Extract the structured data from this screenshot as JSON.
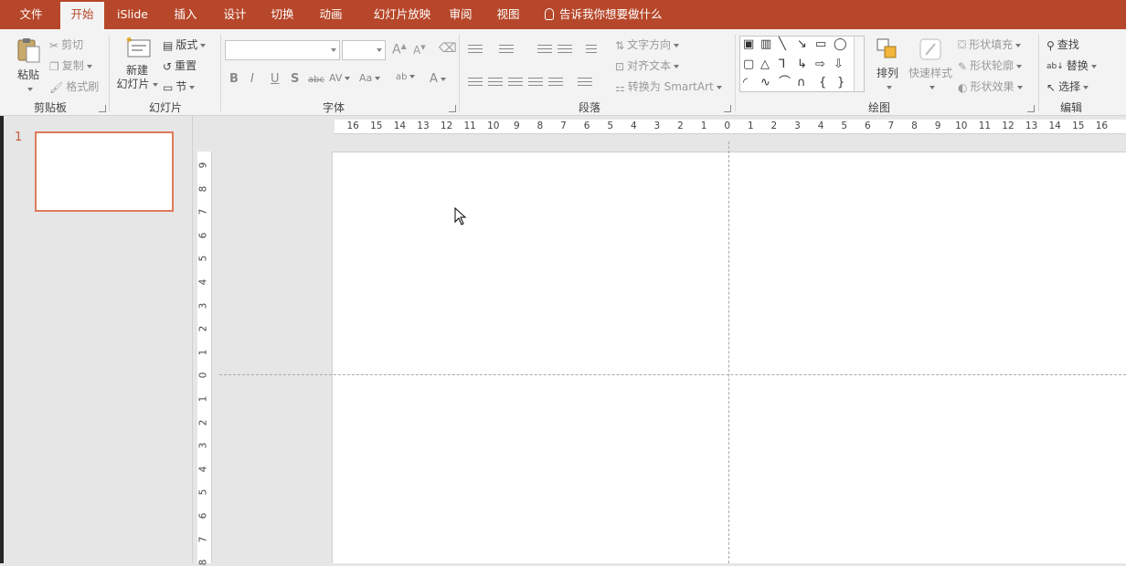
{
  "menu": {
    "tabs": [
      {
        "label": "文件",
        "active": false
      },
      {
        "label": "开始",
        "active": true
      },
      {
        "label": "iSlide",
        "active": false
      },
      {
        "label": "插入",
        "active": false
      },
      {
        "label": "设计",
        "active": false
      },
      {
        "label": "切换",
        "active": false
      },
      {
        "label": "动画",
        "active": false
      },
      {
        "label": "幻灯片放映",
        "active": false
      },
      {
        "label": "审阅",
        "active": false
      },
      {
        "label": "视图",
        "active": false
      }
    ],
    "tell_me": "告诉我你想要做什么"
  },
  "ribbon": {
    "clipboard": {
      "label": "剪贴板",
      "paste": "粘贴",
      "cut": "剪切",
      "copy": "复制",
      "format_painter": "格式刷"
    },
    "slides": {
      "label": "幻灯片",
      "new_slide_line1": "新建",
      "new_slide_line2": "幻灯片",
      "layout": "版式",
      "reset": "重置",
      "section": "节"
    },
    "font": {
      "label": "字体",
      "font_name": "",
      "font_size": "",
      "grow": "A",
      "shrink": "A",
      "bold": "B",
      "italic": "I",
      "underline": "U",
      "shadow": "S",
      "strikethrough": "abc",
      "spacing": "AV",
      "case": "Aa",
      "highlight": "ab",
      "color": "A"
    },
    "paragraph": {
      "label": "段落",
      "text_direction": "文字方向",
      "align_text": "对齐文本",
      "smartart": "转换为 SmartArt"
    },
    "drawing": {
      "label": "绘图",
      "arrange": "排列",
      "quick_styles": "快速样式",
      "shape_fill": "形状填充",
      "shape_outline": "形状轮廓",
      "shape_effects": "形状效果"
    },
    "editing": {
      "label": "编辑",
      "find": "查找",
      "replace": "替换",
      "select": "选择"
    }
  },
  "thumbnails": {
    "slide_number": "1"
  },
  "ruler": {
    "horizontal": [
      "16",
      "15",
      "14",
      "13",
      "12",
      "11",
      "10",
      "9",
      "8",
      "7",
      "6",
      "5",
      "4",
      "3",
      "2",
      "1",
      "0",
      "1",
      "2",
      "3",
      "4",
      "5",
      "6",
      "7",
      "8",
      "9",
      "10",
      "11",
      "12",
      "13",
      "14",
      "15",
      "16"
    ],
    "vertical": [
      "9",
      "8",
      "7",
      "6",
      "5",
      "4",
      "3",
      "2",
      "1",
      "0",
      "1",
      "2",
      "3",
      "4",
      "5",
      "6",
      "7",
      "8"
    ]
  },
  "colors": {
    "accent": "#b7472a",
    "selection": "#e0795b",
    "ribbon_bg": "#f3f3f3",
    "workspace": "#e6e6e6"
  }
}
